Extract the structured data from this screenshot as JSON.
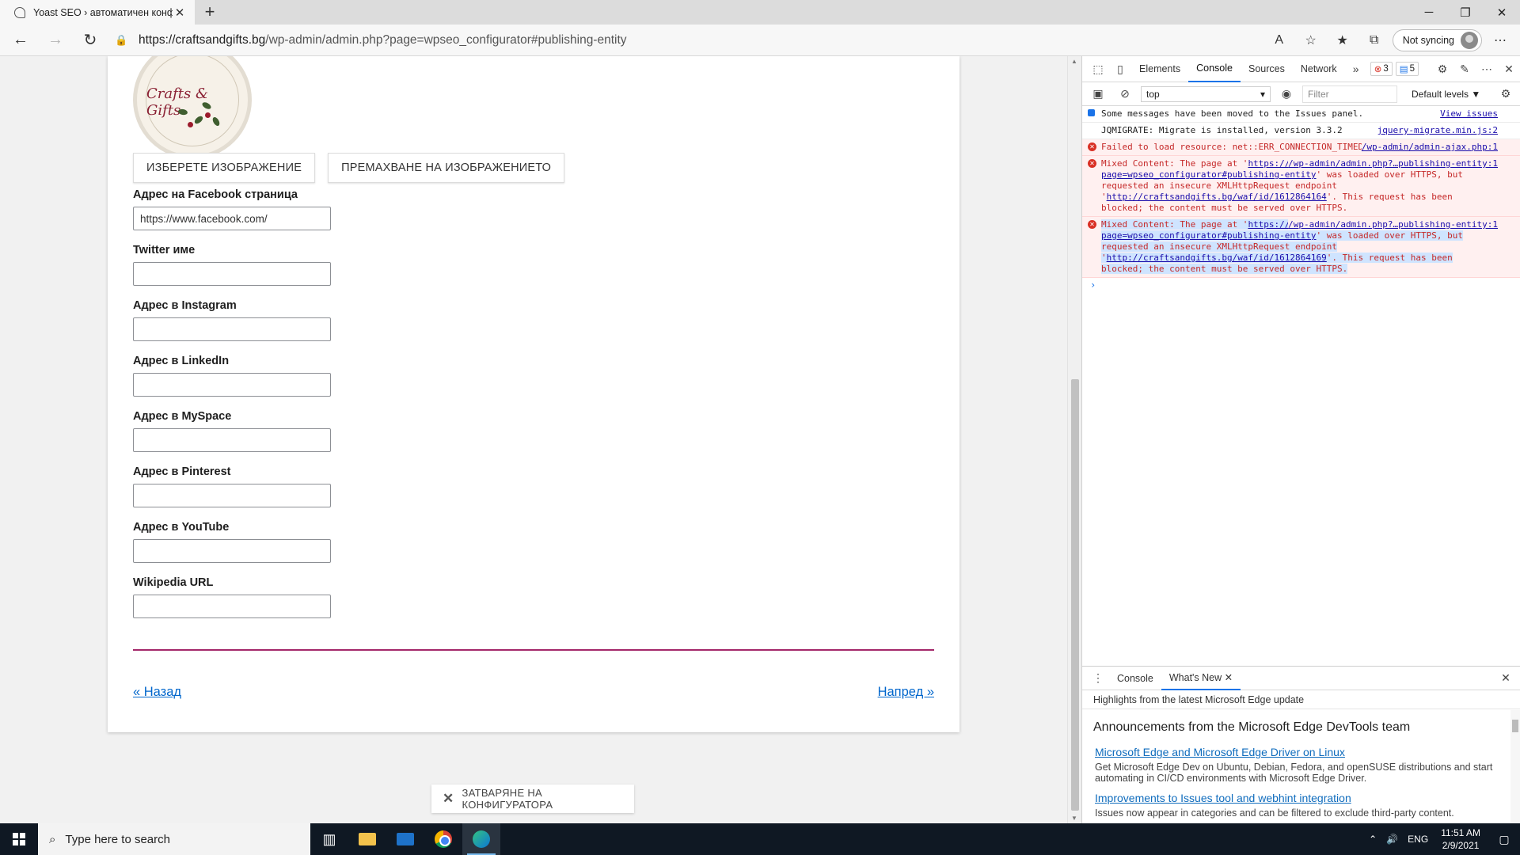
{
  "browser": {
    "tab_title": "Yoast SEO › автоматичен конфигуратор",
    "url_host": "https://craftsandgifts.bg",
    "url_path": "/wp-admin/admin.php?page=wpseo_configurator#publishing-entity",
    "sync_label": "Not syncing"
  },
  "page": {
    "logo_text": "Crafts & Gifts",
    "choose_image": "ИЗБЕРЕТЕ ИЗОБРАЖЕНИЕ",
    "remove_image": "ПРЕМАХВАНЕ НА ИЗОБРАЖЕНИЕТО",
    "fields": [
      {
        "label": "Адрес на Facebook страница",
        "value": "https://www.facebook.com/"
      },
      {
        "label": "Twitter име",
        "value": ""
      },
      {
        "label": "Адрес в Instagram",
        "value": ""
      },
      {
        "label": "Адрес в LinkedIn",
        "value": ""
      },
      {
        "label": "Адрес в MySpace",
        "value": ""
      },
      {
        "label": "Адрес в Pinterest",
        "value": ""
      },
      {
        "label": "Адрес в YouTube",
        "value": ""
      },
      {
        "label": "Wikipedia URL",
        "value": ""
      }
    ],
    "back_link": "« Назад",
    "next_link": "Напред »",
    "close_configurator": "ЗАТВАРЯНЕ НА КОНФИГУРАТОРА",
    "accent_color": "#a4286a"
  },
  "devtools": {
    "tabs": [
      "Elements",
      "Console",
      "Sources",
      "Network"
    ],
    "active_tab": "Console",
    "error_count": "3",
    "message_count": "5",
    "context": "top",
    "filter_placeholder": "Filter",
    "levels": "Default levels ▼",
    "messages": [
      {
        "type": "info",
        "text": "Some messages have been moved to the Issues panel.",
        "src": "View issues"
      },
      {
        "type": "log",
        "text": "JQMIGRATE: Migrate is installed, version 3.3.2",
        "src": "jquery-migrate.min.js:2"
      },
      {
        "type": "error",
        "text": "Failed to load resource: net::ERR_CONNECTION_TIMED_OUT",
        "src": "/wp-admin/admin-ajax.php:1"
      },
      {
        "type": "error",
        "pre": "Mixed Content: The page at '",
        "link1": "https://craftsandgifts.bg/wp-admin/admin.php?page=wpseo_configurator#publishing-entity",
        "mid": "' was loaded over HTTPS, but requested an insecure XMLHttpRequest endpoint '",
        "link2": "http://craftsandgifts.bg/waf/id/1612864164",
        "post": "'. This request has been blocked; the content must be served over HTTPS.",
        "src": "/wp-admin/admin.php?…publishing-entity:1"
      },
      {
        "type": "error",
        "pre": "Mixed Content: The page at '",
        "link1": "https://craftsandgifts.bg/wp-admin/admin.php?page=wpseo_configurator#publishing-entity",
        "mid": "' was loaded over HTTPS, but requested an insecure XMLHttpRequest endpoint '",
        "link2": "http://craftsandgifts.bg/waf/id/1612864169",
        "post": "'. This request has been blocked; the content must be served over HTTPS.",
        "src": "/wp-admin/admin.php?…publishing-entity:1"
      }
    ],
    "drawer_tabs": [
      "Console",
      "What's New"
    ],
    "drawer_subtitle": "Highlights from the latest Microsoft Edge update",
    "whats_new_heading": "Announcements from the Microsoft Edge DevTools team",
    "whats_new_items": [
      {
        "title": "Microsoft Edge and Microsoft Edge Driver on Linux",
        "desc": "Get Microsoft Edge Dev on Ubuntu, Debian, Fedora, and openSUSE distributions and start automating in CI/CD environments with Microsoft Edge Driver."
      },
      {
        "title": "Improvements to Issues tool and webhint integration",
        "desc": "Issues now appear in categories and can be filtered to exclude third-party content."
      }
    ]
  },
  "taskbar": {
    "search_placeholder": "Type here to search",
    "lang": "ENG",
    "time": "11:51 AM",
    "date": "2/9/2021"
  }
}
